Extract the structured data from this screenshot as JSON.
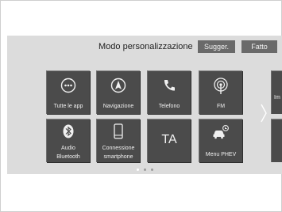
{
  "header": {
    "title": "Modo personalizzazione",
    "sugger_label": "Sugger.",
    "fatto_label": "Fatto"
  },
  "tiles": {
    "tutte_le_app": "Tutte le app",
    "navigazione": "Navigazione",
    "telefono": "Telefono",
    "fm": "FM",
    "audio_bluetooth_line1": "Audio",
    "audio_bluetooth_line2": "Bluetooth",
    "connessione_line1": "Connessione",
    "connessione_line2": "smartphone",
    "ta": "TA",
    "menu_phev": "Menu PHEV",
    "next_partial": "Im"
  },
  "pager": {
    "pages": 3,
    "current": 1
  },
  "colors": {
    "tile": "#4b4b4b",
    "screen": "#dcdcdc",
    "header_button": "#6a6a6a"
  }
}
